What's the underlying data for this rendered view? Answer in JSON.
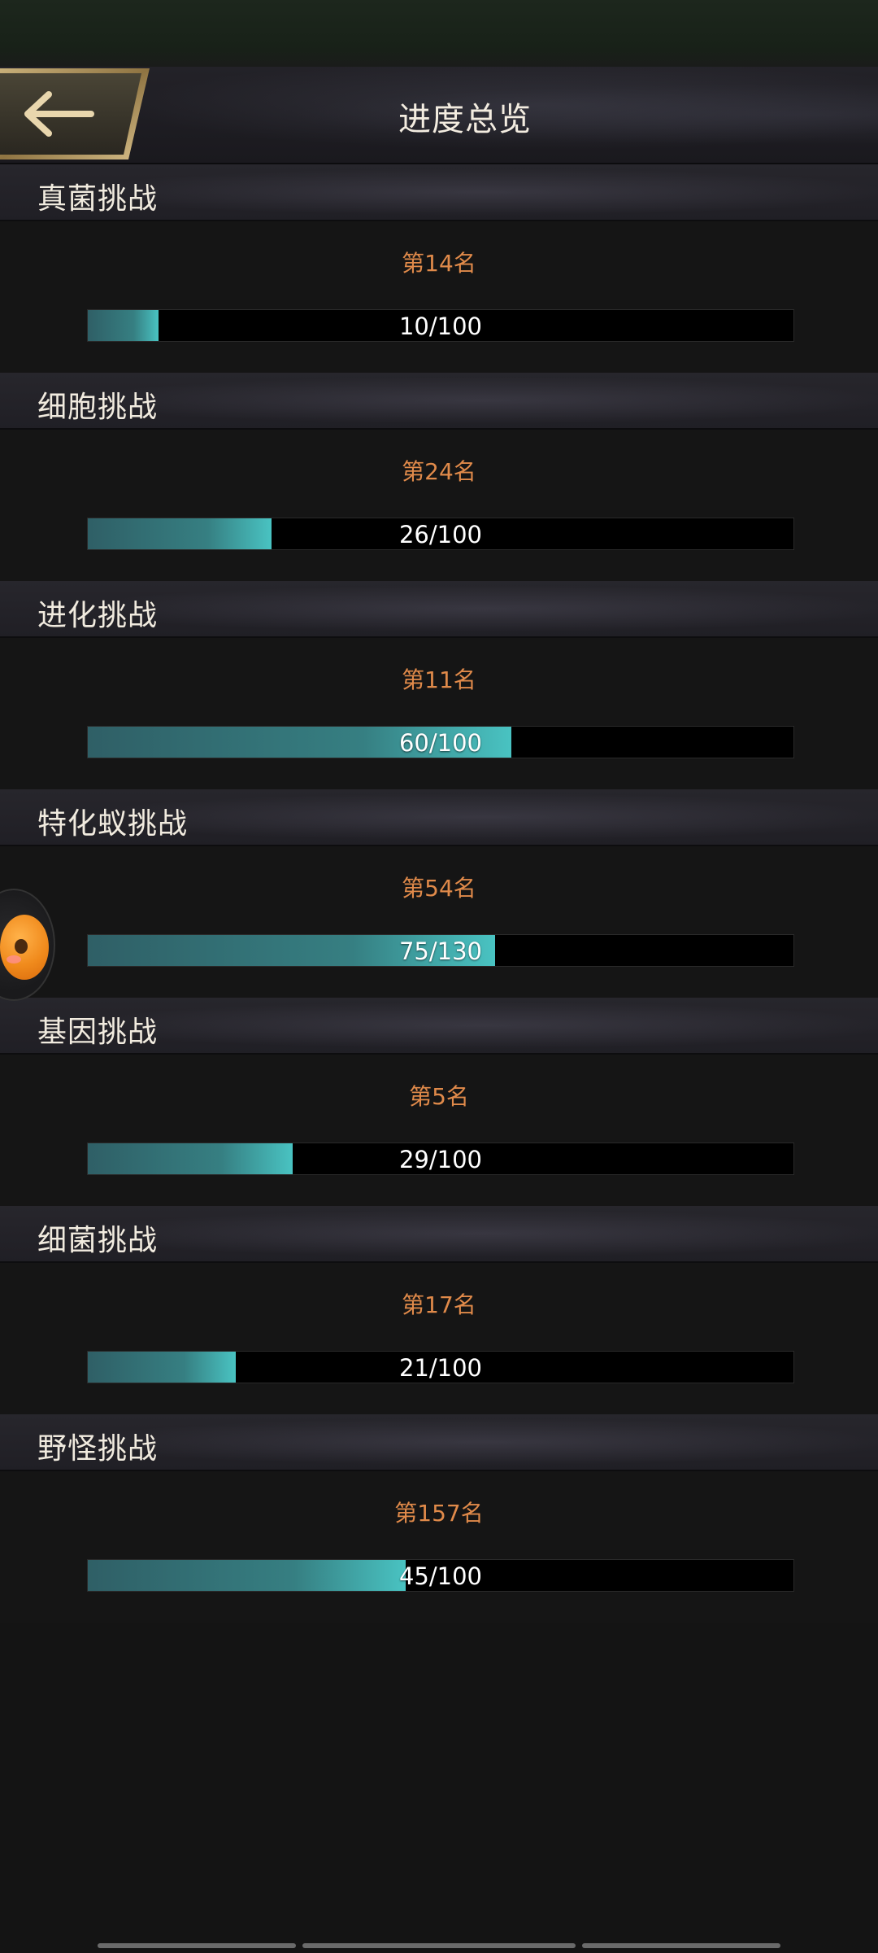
{
  "header": {
    "title": "进度总览",
    "back_icon": "arrow-left-icon"
  },
  "colors": {
    "rank_text": "#e08a4a",
    "fill_start": "#2f5f66",
    "fill_end": "#49c3c2",
    "track": "#000000"
  },
  "sections": [
    {
      "title": "真菌挑战",
      "rank": "第14名",
      "progress_text": "10/100",
      "current": 10,
      "total": 100
    },
    {
      "title": "细胞挑战",
      "rank": "第24名",
      "progress_text": "26/100",
      "current": 26,
      "total": 100
    },
    {
      "title": "进化挑战",
      "rank": "第11名",
      "progress_text": "60/100",
      "current": 60,
      "total": 100
    },
    {
      "title": "特化蚁挑战",
      "rank": "第54名",
      "progress_text": "75/130",
      "current": 75,
      "total": 130
    },
    {
      "title": "基因挑战",
      "rank": "第5名",
      "progress_text": "29/100",
      "current": 29,
      "total": 100
    },
    {
      "title": "细菌挑战",
      "rank": "第17名",
      "progress_text": "21/100",
      "current": 21,
      "total": 100
    },
    {
      "title": "野怪挑战",
      "rank": "第157名",
      "progress_text": "45/100",
      "current": 45,
      "total": 100
    }
  ],
  "mascot": {
    "icon": "mascot-avatar-icon"
  }
}
